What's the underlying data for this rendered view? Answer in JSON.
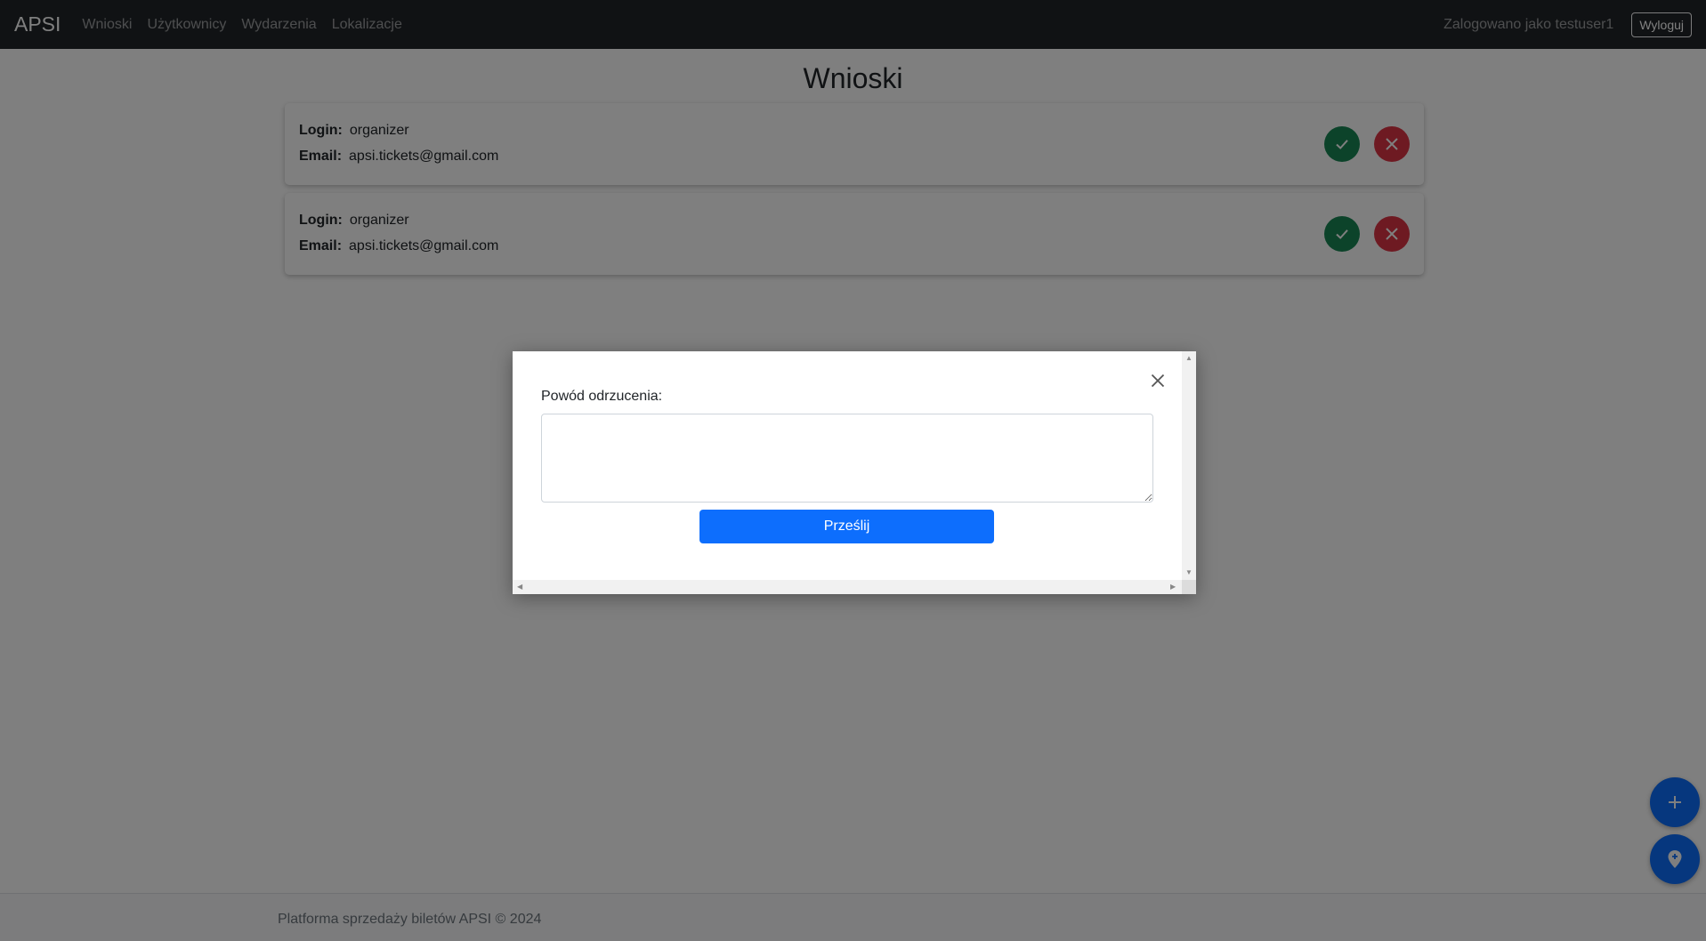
{
  "navbar": {
    "brand": "APSI",
    "links": [
      "Wnioski",
      "Użytkownicy",
      "Wydarzenia",
      "Lokalizacje"
    ],
    "logged_in_text": "Zalogowano jako testuser1",
    "logout_label": "Wyloguj"
  },
  "page": {
    "title": "Wnioski"
  },
  "requests": [
    {
      "login_label": "Login:",
      "login": "organizer",
      "email_label": "Email:",
      "email": "apsi.tickets@gmail.com"
    },
    {
      "login_label": "Login:",
      "login": "organizer",
      "email_label": "Email:",
      "email": "apsi.tickets@gmail.com"
    }
  ],
  "modal": {
    "reason_label": "Powód odrzucenia:",
    "reason_value": "",
    "submit_label": "Prześlij"
  },
  "footer": {
    "text": "Platforma sprzedaży biletów APSI © 2024"
  },
  "colors": {
    "navbar": "#212529",
    "accept": "#198754",
    "reject": "#dc3545",
    "primary": "#0d6efd"
  }
}
